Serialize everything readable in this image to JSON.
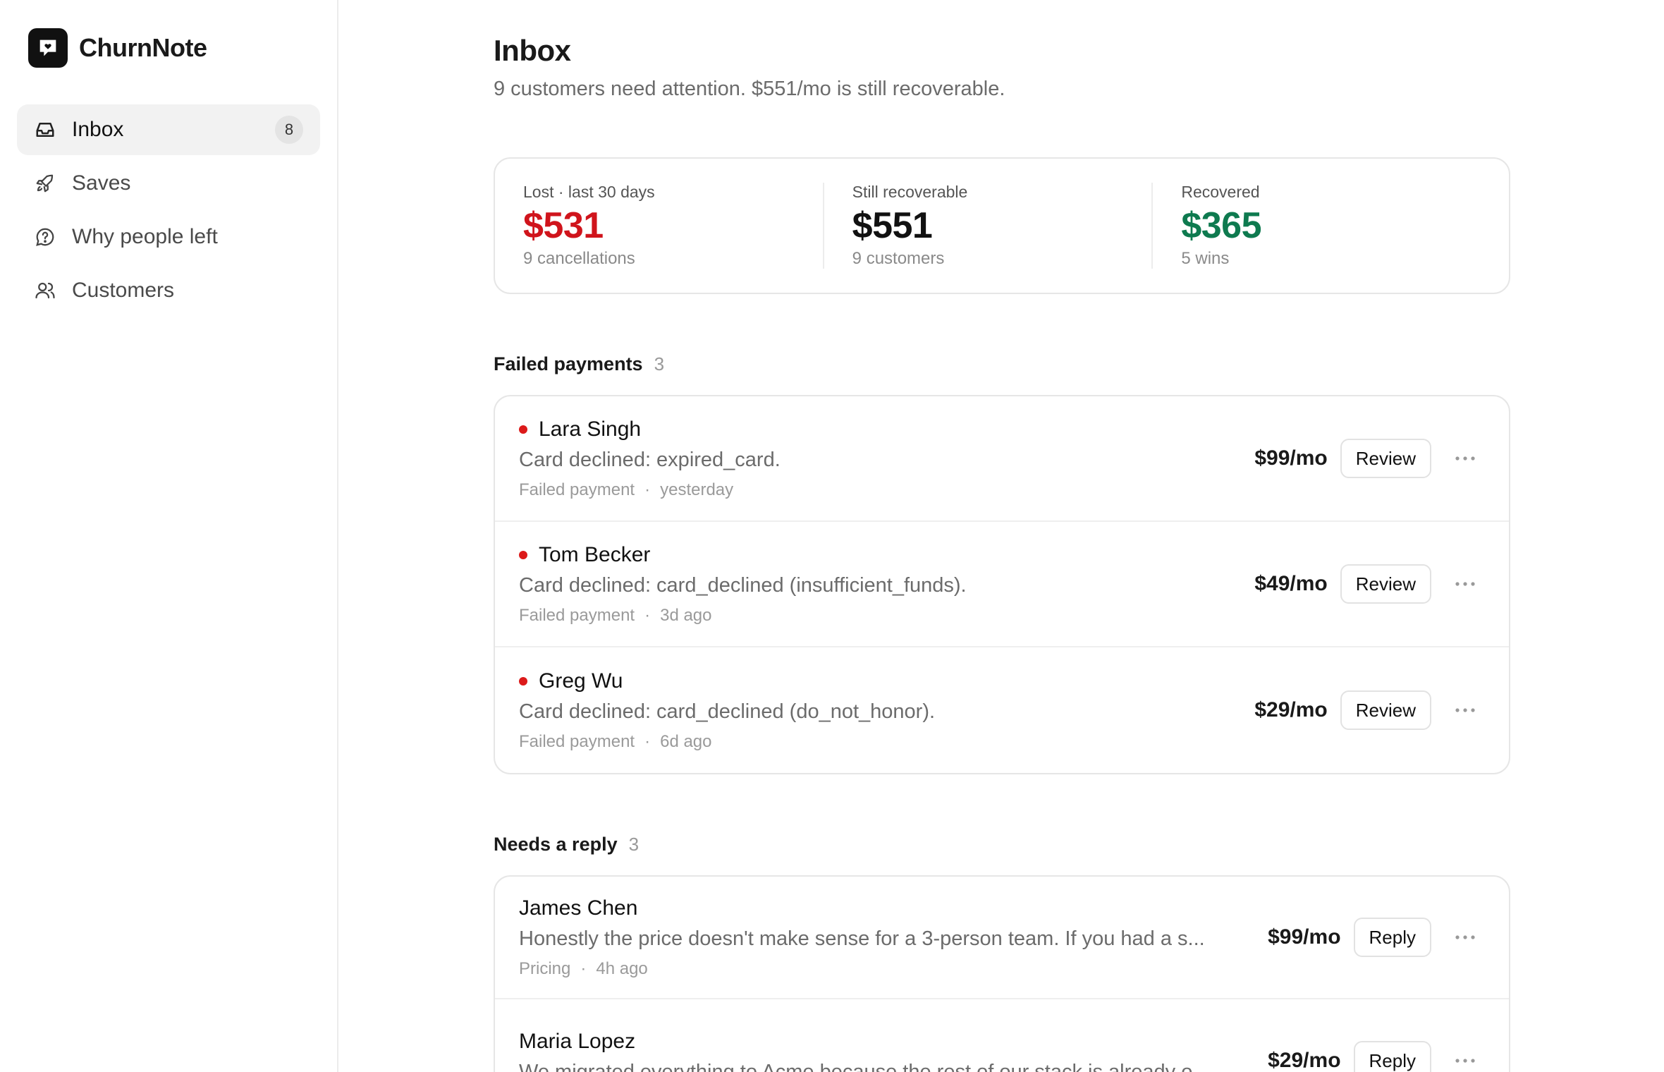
{
  "app": {
    "name": "ChurnNote"
  },
  "sidebar": {
    "items": [
      {
        "label": "Inbox",
        "badge": "8",
        "icon": "inbox-icon",
        "active": true
      },
      {
        "label": "Saves",
        "icon": "rocket-icon"
      },
      {
        "label": "Why people left",
        "icon": "question-bubble-icon"
      },
      {
        "label": "Customers",
        "icon": "users-icon"
      }
    ]
  },
  "page": {
    "title": "Inbox",
    "subtitle": "9 customers need attention. $551/mo is still recoverable."
  },
  "stats": [
    {
      "label": "Lost · last 30 days",
      "value": "$531",
      "sub": "9 cancellations",
      "color": "#d0141c"
    },
    {
      "label": "Still recoverable",
      "value": "$551",
      "sub": "9 customers",
      "color": "#111111"
    },
    {
      "label": "Recovered",
      "value": "$365",
      "sub": "5 wins",
      "color": "#0e7a4f"
    }
  ],
  "failed_payments": {
    "title": "Failed payments",
    "count": "3",
    "rows": [
      {
        "name": "Lara Singh",
        "desc": "Card declined: expired_card.",
        "type": "Failed payment",
        "sep": "·",
        "time": "yesterday",
        "price": "$99/mo",
        "action": "Review"
      },
      {
        "name": "Tom Becker",
        "desc": "Card declined: card_declined (insufficient_funds).",
        "type": "Failed payment",
        "sep": "·",
        "time": "3d ago",
        "price": "$49/mo",
        "action": "Review"
      },
      {
        "name": "Greg Wu",
        "desc": "Card declined: card_declined (do_not_honor).",
        "type": "Failed payment",
        "sep": "·",
        "time": "6d ago",
        "price": "$29/mo",
        "action": "Review"
      }
    ]
  },
  "needs_reply": {
    "title": "Needs a reply",
    "count": "3",
    "rows": [
      {
        "name": "James Chen",
        "desc": "Honestly the price doesn't make sense for a 3-person team. If you had a s...",
        "type": "Pricing",
        "sep": "·",
        "time": "4h ago",
        "price": "$99/mo",
        "action": "Reply"
      },
      {
        "name": "Maria Lopez",
        "desc": "We migrated everything to Acme because the rest of our stack is already o...",
        "type": "",
        "sep": "",
        "time": "",
        "price": "$29/mo",
        "action": "Reply"
      }
    ]
  }
}
